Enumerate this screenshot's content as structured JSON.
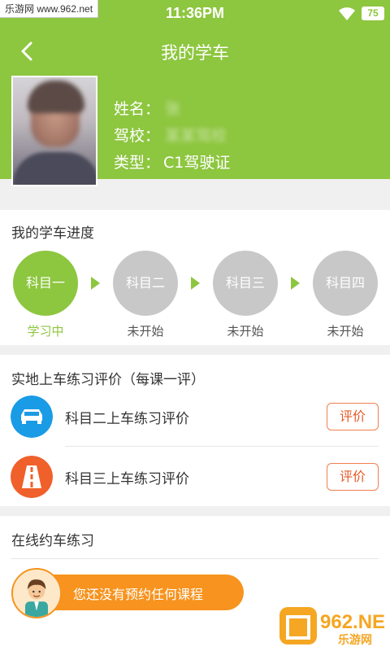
{
  "status_bar": {
    "watermark": "乐游网 www.962.net",
    "time": "11:36PM",
    "battery": "75"
  },
  "header": {
    "title": "我的学车",
    "name_label": "姓名：",
    "name_value": "张",
    "school_label": "驾校：",
    "school_value": "某某驾校",
    "type_label": "类型：",
    "type_value": "C1驾驶证"
  },
  "progress": {
    "title": "我的学车进度",
    "steps": [
      {
        "name": "科目一",
        "status": "学习中"
      },
      {
        "name": "科目二",
        "status": "未开始"
      },
      {
        "name": "科目三",
        "status": "未开始"
      },
      {
        "name": "科目四",
        "status": "未开始"
      }
    ]
  },
  "evaluation": {
    "title": "实地上车练习评价（每课一评）",
    "items": [
      {
        "label": "科目二上车练习评价",
        "button": "评价",
        "icon": "car-icon",
        "color": "#1a9be6"
      },
      {
        "label": "科目三上车练习评价",
        "button": "评价",
        "icon": "road-icon",
        "color": "#f0602a"
      }
    ]
  },
  "booking": {
    "title": "在线约车练习",
    "empty_text": "您还没有预约任何课程"
  },
  "colors": {
    "primary": "#8dc63f",
    "accent": "#f7931e"
  },
  "logo": {
    "text": "962.NET",
    "sub": "乐游网"
  }
}
